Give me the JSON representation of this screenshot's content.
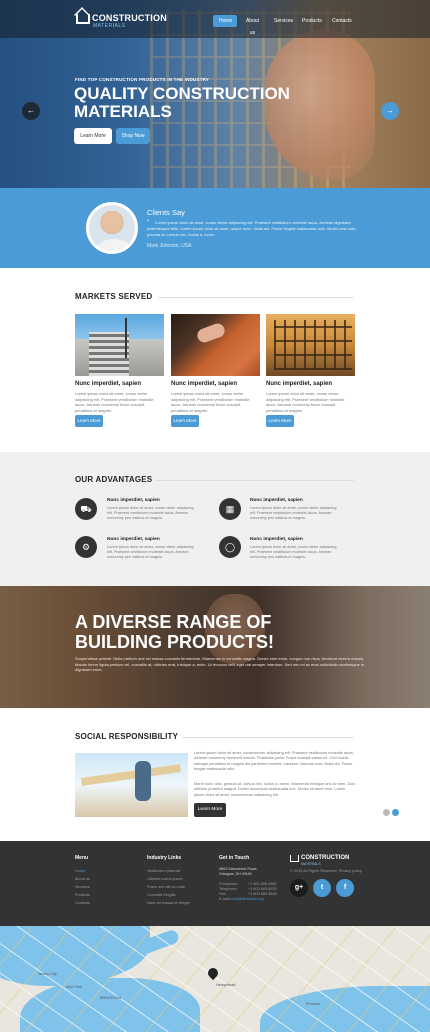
{
  "header": {
    "logo_title": "CONSTRUCTION",
    "logo_subtitle": "MATERIALS",
    "nav": [
      "Home",
      "About us",
      "Services",
      "Products",
      "Contacts"
    ]
  },
  "hero": {
    "kicker": "FIND TOP CONSTRUCTION PRODUCTS IN THE INDUSTRY",
    "title": "QUALITY CONSTRUCTION MATERIALS",
    "learn_more": "Learn More",
    "shop_now": "Shop Now",
    "prev_icon": "arrow-left-icon",
    "next_icon": "arrow-right-icon"
  },
  "testimonial": {
    "title": "Clients Say",
    "quote": "Lorem ipsum dolor sit amet, conse ctetur adipiscing elit. Praesent vestibulum molestie lacus. Aenean dignissim pellentesque felis. Lorem ipsum dolor sit amet, neque enim. Nulla dui. Fusce feugiat malesuada odio. Morbi nunc odio, gravida at, cursus nec, luctus a, lorem.",
    "name": "Mark Johnson, USA"
  },
  "markets": {
    "title": "MARKETS SERVED",
    "cards": [
      {
        "title": "Nunc imperdiet, sapien",
        "text": "Lorem ipsum dolor sit amet, conse ctetur adipiscing elit. Praesent vestibulum molestie lacus. Aenean nonummy fusce suscipit, penatibus et magnis.",
        "button": "Learn More"
      },
      {
        "title": "Nunc imperdiet, sapien",
        "text": "Lorem ipsum dolor sit amet, conse ctetur adipiscing elit. Praesent vestibulum molestie lacus. Aenean nonummy fusce suscipit, penatibus et magnis.",
        "button": "Learn More"
      },
      {
        "title": "Nunc imperdiet, sapien",
        "text": "Lorem ipsum dolor sit amet, conse ctetur adipiscing elit. Praesent vestibulum molestie lacus. Aenean nonummy fusce suscipit, penatibus et magnis.",
        "button": "Learn More"
      }
    ]
  },
  "advantages": {
    "title": "OUR ADVANTAGES",
    "items": [
      {
        "title": "Nunc imperdiet, sapien",
        "text": "Lorem ipsum dolor sit amet, conse ctetur adipiscing elit. Praesent vestibulum molestie lacus. Aenean nonummy pen natibus et magnis.",
        "icon": "truck-icon"
      },
      {
        "title": "Nunc imperdiet, sapien",
        "text": "Lorem ipsum dolor sit amet, conse ctetur adipiscing elit. Praesent vestibulum molestie lacus. Aenean nonummy pen natibus et magnis.",
        "icon": "calendar-icon"
      },
      {
        "title": "Nunc imperdiet, sapien",
        "text": "Lorem ipsum dolor sit amet, conse ctetur adipiscing elit. Praesent vestibulum molestie lacus. Aenean nonummy pen natibus et magnis.",
        "icon": "gear-icon"
      },
      {
        "title": "Nunc imperdiet, sapien",
        "text": "Lorem ipsum dolor sit amet, conse ctetur adipiscing elit. Praesent vestibulum molestie lacus. Aenean nonummy pen natibus et magnis.",
        "icon": "user-icon"
      }
    ]
  },
  "banner": {
    "title": "A DIVERSE RANGE OF BUILDING PRODUCTS!",
    "text": "Suspendisse potenti. Nulla pretium orci vel massa convallis fermentum. Maecenas in convallis magna. Donec sem enim, congue non risus, tincidunt viverra mauris. Mauris lorem ligula pretium vel, convallis at, ultricies erat, tristique a, enim. Ut rhoncus velit eget nisi semper interdum. Sed nec mi ac eros sollicitudin scelerisque in dignissim enim."
  },
  "social": {
    "title": "SOCIAL RESPONSIBILITY",
    "paragraph1": "Lorem ipsum dolor sit amet, consectetuer adipiscing elit. Praesent vestibulum molestie lacus. Aenean nonummy hendrerit mauris. Phasellus porta. Fusce suscipit varius mi. Cum sociis natoque penatibus et magnis dis parturient montes, nascetur ridiculus mus. Nulla dui. Fusce feugiat malesuada odio.",
    "paragraph2": "Morbi nunc odio, gravida at, cursus nec, luctus a, lorem. Maecenas tristique orci ac sem. Duis ultricies pharetra magna. Donec accumsan malesuada orci. Donec sit amet eros. Lorem ipsum dolor sit amet, consectetuer adipiscing elit.",
    "button": "Learn More"
  },
  "footer": {
    "menu_title": "Menu",
    "menu": [
      "Home",
      "About us",
      "Services",
      "Products",
      "Contacts"
    ],
    "industry_title": "Industry Links",
    "industry": [
      "Vestibulum placerat",
      "Ultricies luctus ipsum",
      "Fusce sed elit ac nulla",
      "Convallis fringilla",
      "Nam vel massa id integer"
    ],
    "contact_title": "Get in Touch",
    "address": "9863 Mainstreet Road, Glasgow, DH 89UB.",
    "freephone_label": "Freephone:",
    "freephone": "+1 800 559 6580",
    "telephone_label": "Telephone:",
    "telephone": "+1 800 603 6035",
    "fax_label": "Fax:",
    "fax": "+1 800 889 9898",
    "email_label": "E-mail:",
    "email": "mail@demolink.org",
    "logo_title": "CONSTRUCTION",
    "logo_subtitle": "MATERIALS",
    "copyright": "© 2015 All Rights Reserved. Privacy policy",
    "socials": [
      {
        "glyph": "g+",
        "icon": "google-plus-icon"
      },
      {
        "glyph": "t",
        "icon": "twitter-icon"
      },
      {
        "glyph": "f",
        "icon": "facebook-icon"
      }
    ]
  },
  "map": {
    "labels": [
      "Jersey City",
      "New York",
      "BROOKLYN",
      "Hempstead",
      "Freeport"
    ]
  },
  "colors": {
    "accent": "#4a9bd6",
    "dark": "#333333",
    "light_bg": "#f0f0f0"
  }
}
